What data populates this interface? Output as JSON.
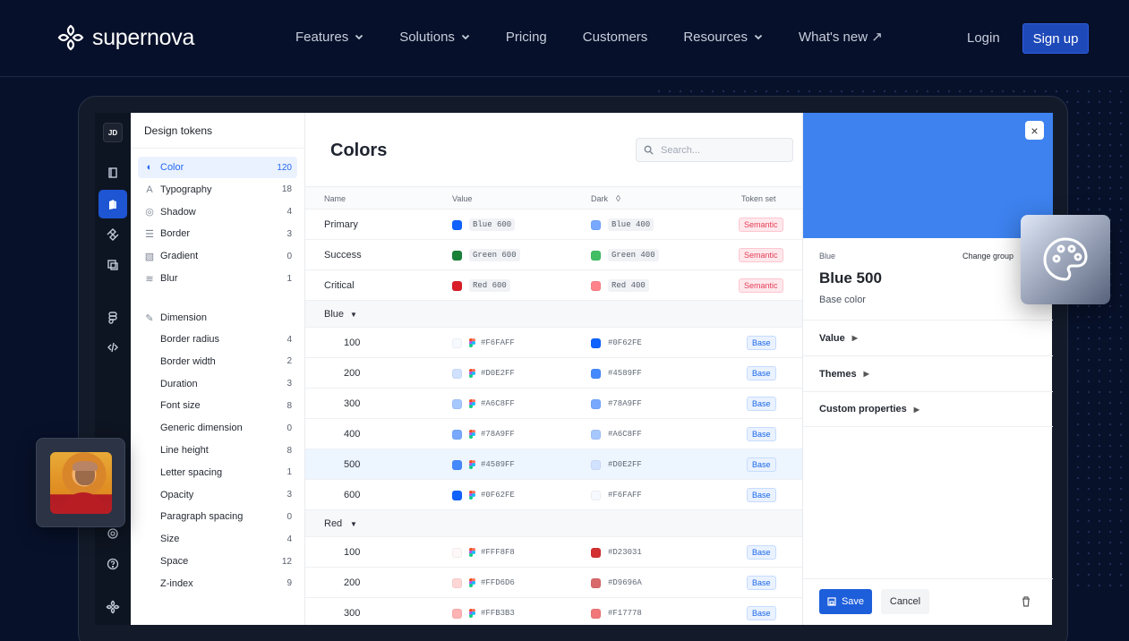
{
  "brand": {
    "name": "supernova"
  },
  "nav": {
    "items": [
      {
        "label": "Features",
        "has_dropdown": true
      },
      {
        "label": "Solutions",
        "has_dropdown": true
      },
      {
        "label": "Pricing",
        "has_dropdown": false
      },
      {
        "label": "Customers",
        "has_dropdown": false
      },
      {
        "label": "Resources",
        "has_dropdown": true
      },
      {
        "label": "What's new ↗",
        "has_dropdown": false
      }
    ],
    "login": "Login",
    "signup": "Sign up"
  },
  "app": {
    "user_initials": "JD",
    "sidebar_title": "Design tokens",
    "tokens": [
      {
        "label": "Color",
        "count": "120",
        "icon": "palette-icon",
        "active": true
      },
      {
        "label": "Typography",
        "count": "18",
        "icon": "typography-icon"
      },
      {
        "label": "Shadow",
        "count": "4",
        "icon": "shadow-icon"
      },
      {
        "label": "Border",
        "count": "3",
        "icon": "border-icon"
      },
      {
        "label": "Gradient",
        "count": "0",
        "icon": "gradient-icon"
      },
      {
        "label": "Blur",
        "count": "1",
        "icon": "blur-icon"
      }
    ],
    "dimension_title": "Dimension",
    "dimensions": [
      {
        "label": "Border radius",
        "count": "4"
      },
      {
        "label": "Border width",
        "count": "2"
      },
      {
        "label": "Duration",
        "count": "3"
      },
      {
        "label": "Font size",
        "count": "8"
      },
      {
        "label": "Generic dimension",
        "count": "0"
      },
      {
        "label": "Line height",
        "count": "8"
      },
      {
        "label": "Letter spacing",
        "count": "1"
      },
      {
        "label": "Opacity",
        "count": "3"
      },
      {
        "label": "Paragraph spacing",
        "count": "0"
      },
      {
        "label": "Size",
        "count": "4"
      },
      {
        "label": "Space",
        "count": "12"
      },
      {
        "label": "Z-index",
        "count": "9"
      }
    ]
  },
  "colors_view": {
    "title": "Colors",
    "search_placeholder": "Search...",
    "columns": [
      "Name",
      "Value",
      "Dark",
      "Token set"
    ],
    "semantic_rows": [
      {
        "name": "Primary",
        "value": "Blue 600",
        "value_color": "#0F62FE",
        "dark": "Blue 400",
        "dark_color": "#78A9FF",
        "token_set": "Semantic"
      },
      {
        "name": "Success",
        "value": "Green 600",
        "value_color": "#198038",
        "dark": "Green 400",
        "dark_color": "#42BE65",
        "token_set": "Semantic"
      },
      {
        "name": "Critical",
        "value": "Red 600",
        "value_color": "#DA1E28",
        "dark": "Red 400",
        "dark_color": "#FF8389",
        "token_set": "Semantic"
      }
    ],
    "groups": [
      {
        "name": "Blue",
        "rows": [
          {
            "name": "100",
            "value": "#F6FAFF",
            "dark": "#0F62FE",
            "token_set": "Base"
          },
          {
            "name": "200",
            "value": "#D0E2FF",
            "dark": "#4589FF",
            "token_set": "Base"
          },
          {
            "name": "300",
            "value": "#A6C8FF",
            "dark": "#78A9FF",
            "token_set": "Base"
          },
          {
            "name": "400",
            "value": "#78A9FF",
            "dark": "#A6C8FF",
            "token_set": "Base"
          },
          {
            "name": "500",
            "value": "#4589FF",
            "dark": "#D0E2FF",
            "token_set": "Base",
            "selected": true
          },
          {
            "name": "600",
            "value": "#0F62FE",
            "dark": "#F6FAFF",
            "token_set": "Base"
          }
        ]
      },
      {
        "name": "Red",
        "rows": [
          {
            "name": "100",
            "value": "#FFF8F8",
            "dark": "#D23031",
            "token_set": "Base"
          },
          {
            "name": "200",
            "value": "#FFD6D6",
            "dark": "#D9696A",
            "token_set": "Base"
          },
          {
            "name": "300",
            "value": "#FFB3B3",
            "dark": "#F17778",
            "token_set": "Base"
          }
        ]
      }
    ]
  },
  "detail_panel": {
    "group_label": "Blue",
    "change_group": "Change group",
    "title": "Blue 500",
    "description": "Base color",
    "sections": [
      "Value",
      "Themes",
      "Custom properties"
    ],
    "save": "Save",
    "cancel": "Cancel",
    "header_color": "#3D82EF"
  }
}
